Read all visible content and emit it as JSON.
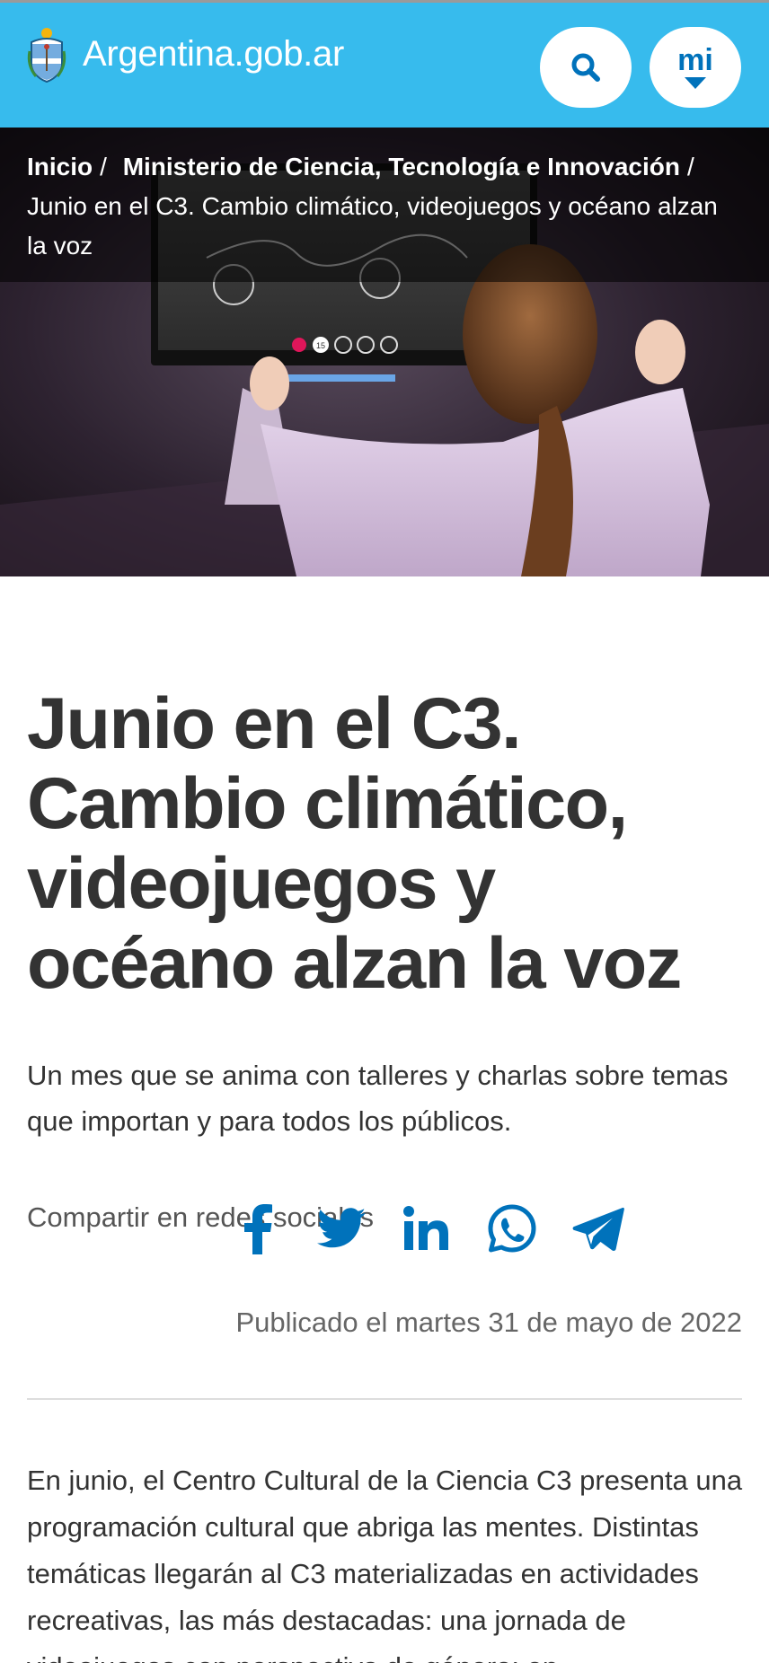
{
  "header": {
    "site_name": "Argentina.gob.ar",
    "search_icon": "search-icon",
    "mi_label": "mi",
    "brand_color": "#37BBED",
    "accent_color": "#0072BB"
  },
  "breadcrumb": {
    "items": [
      {
        "label": "Inicio"
      },
      {
        "label": "Ministerio de Ciencia, Tecnología e Innovación"
      }
    ],
    "separator": "/",
    "current": "Junio en el C3. Cambio climático, videojuegos y océano alzan la voz"
  },
  "hero": {
    "screen_counter": "15"
  },
  "article": {
    "title": "Junio en el C3. Cambio climático, videojuegos y océano alzan la voz",
    "lead": "Un mes que se anima con talleres y charlas sobre temas que importan y para todos los públicos.",
    "share_label": "Compartir en redes sociales",
    "share_networks": [
      {
        "name": "Facebook",
        "icon": "facebook-icon"
      },
      {
        "name": "Twitter",
        "icon": "twitter-icon"
      },
      {
        "name": "LinkedIn",
        "icon": "linkedin-icon"
      },
      {
        "name": "WhatsApp",
        "icon": "whatsapp-icon"
      },
      {
        "name": "Telegram",
        "icon": "telegram-icon"
      }
    ],
    "published": "Publicado el martes 31 de mayo de 2022",
    "body": "En junio, el Centro Cultural de la Ciencia C3 presenta una programación cultural que abriga las mentes. Distintas temáticas llegarán al C3 materializadas en actividades recreativas, las más destacadas: una jornada de videojuegos con perspectiva de género; en"
  }
}
